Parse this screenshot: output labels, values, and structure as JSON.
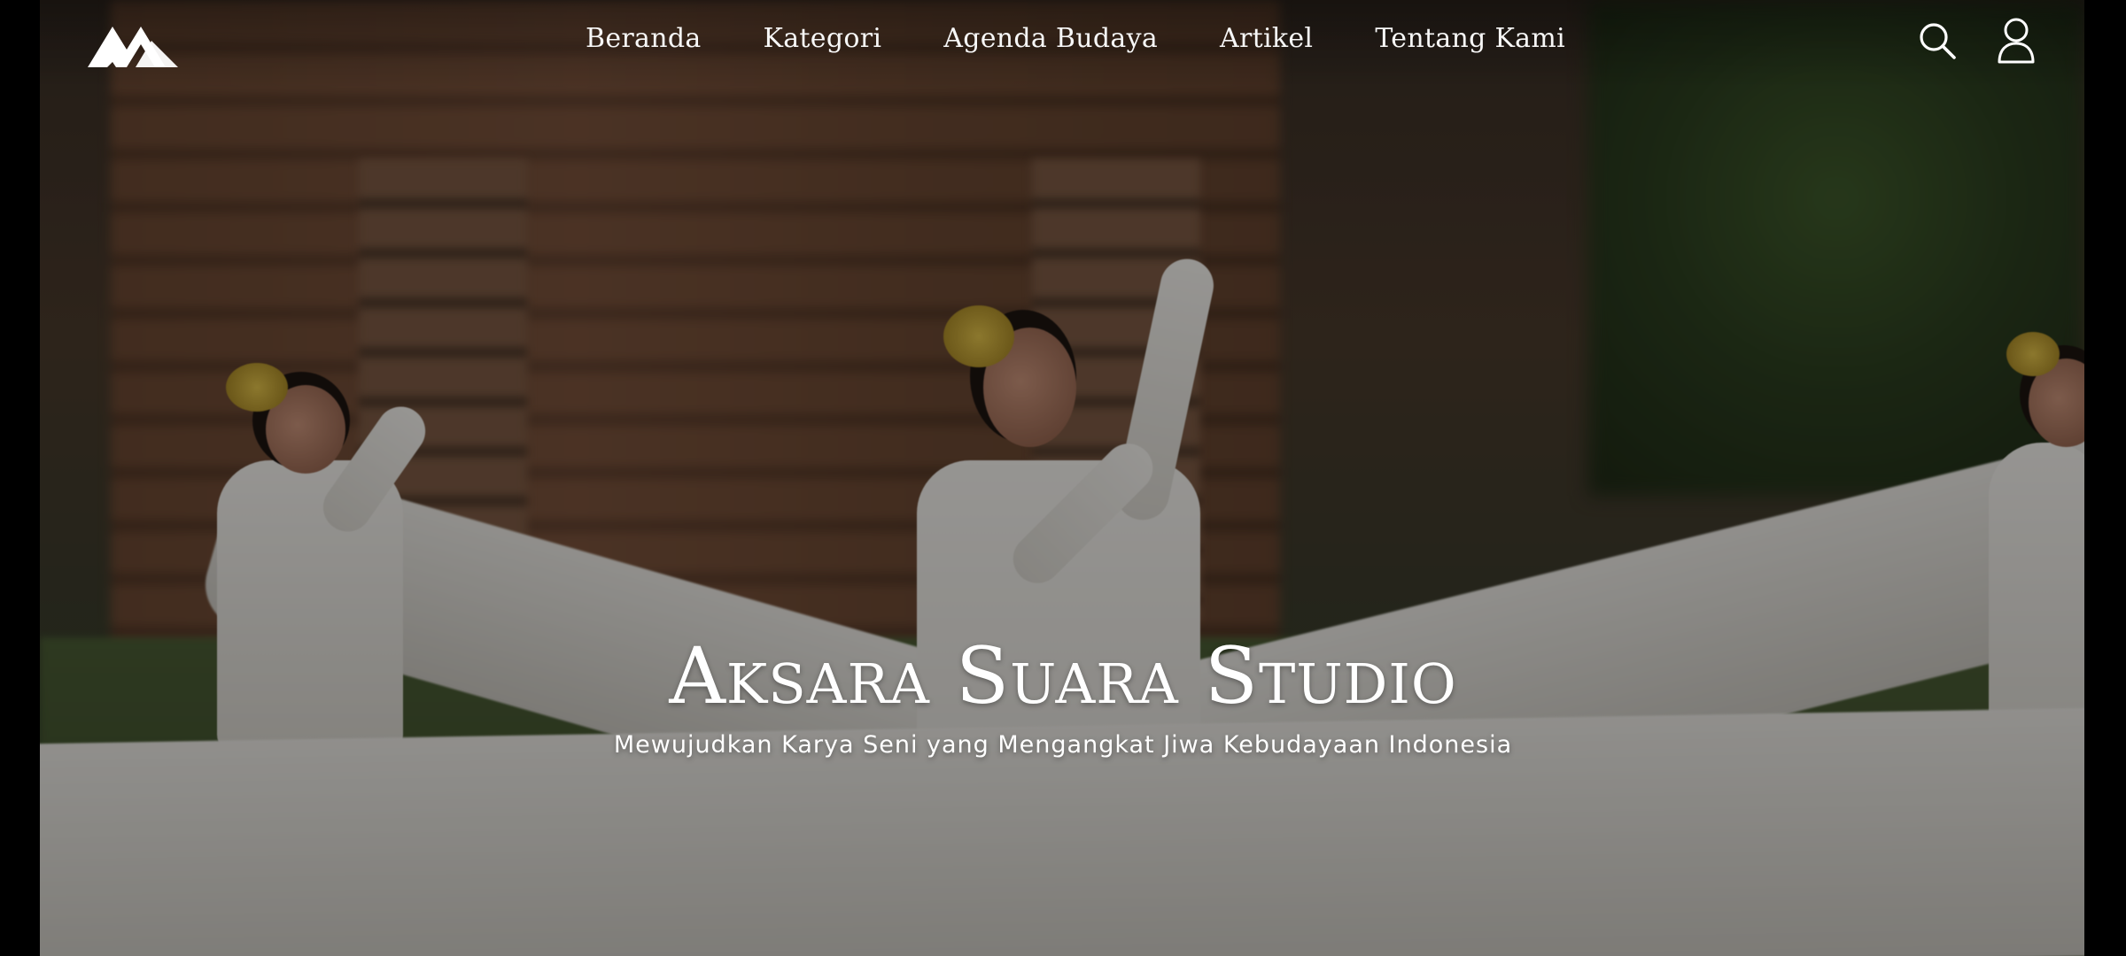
{
  "nav": {
    "items": [
      {
        "label": "Beranda"
      },
      {
        "label": "Kategori"
      },
      {
        "label": "Agenda Budaya"
      },
      {
        "label": "Artikel"
      },
      {
        "label": "Tentang Kami"
      }
    ],
    "icons": [
      "search-icon",
      "user-icon"
    ]
  },
  "hero": {
    "title": "Aksara Suara Studio",
    "subtitle": "Mewujudkan Karya Seni yang Mengangkat Jiwa Kebudayaan Indonesia"
  },
  "colors": {
    "text": "#ffffff",
    "overlay": "#000000"
  }
}
